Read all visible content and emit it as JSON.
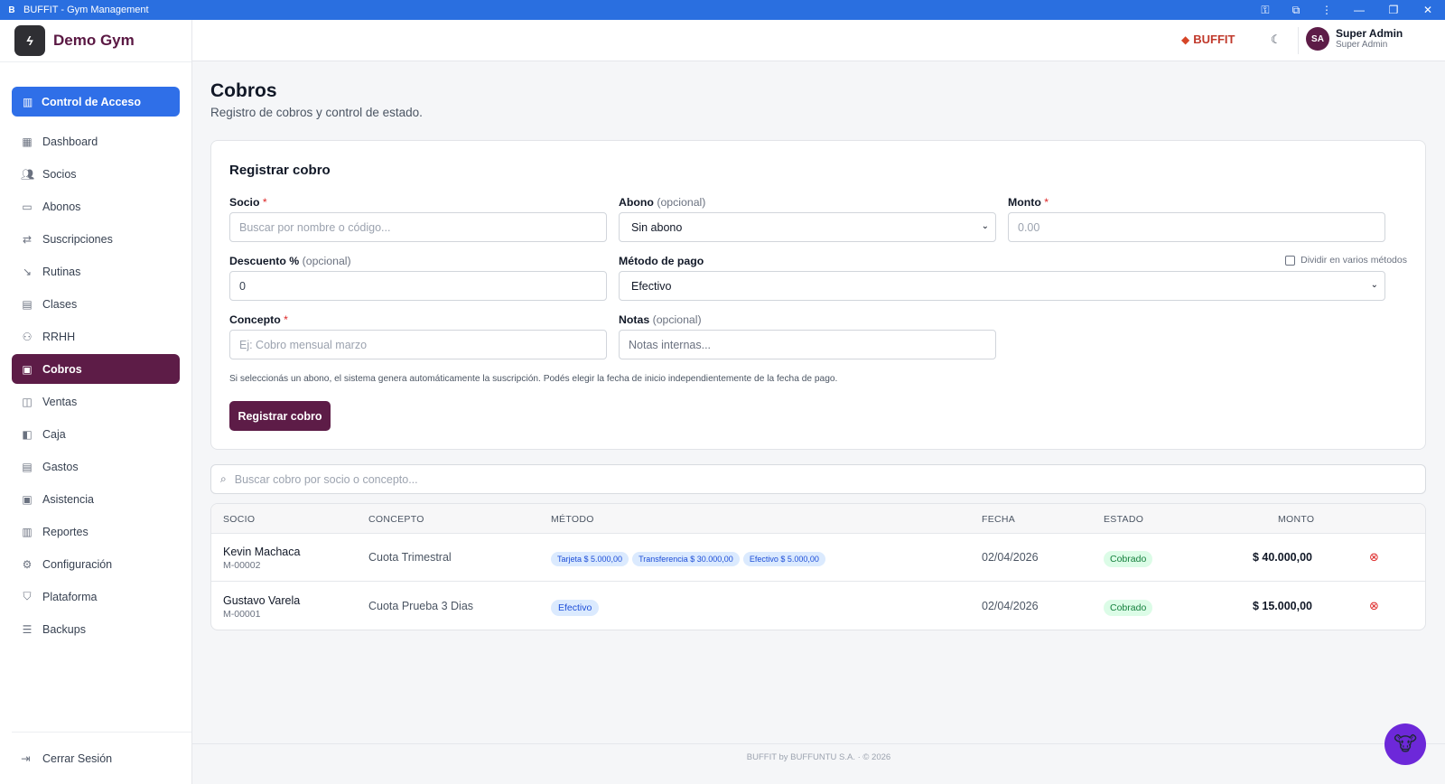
{
  "window": {
    "icon": "B",
    "title": "BUFFIT - Gym Management",
    "accent": "#2a6fe0"
  },
  "sidebar": {
    "brand_name": "Demo Gym",
    "brand_icon": "bolt-logo-icon",
    "access_button": "Control de Acceso",
    "items": [
      {
        "label": "Dashboard",
        "icon": "grid-icon"
      },
      {
        "label": "Socios",
        "icon": "users-icon"
      },
      {
        "label": "Abonos",
        "icon": "card-icon"
      },
      {
        "label": "Suscripciones",
        "icon": "repeat-icon"
      },
      {
        "label": "Rutinas",
        "icon": "dumbbell-icon"
      },
      {
        "label": "Clases",
        "icon": "calendar-icon"
      },
      {
        "label": "RRHH",
        "icon": "staff-icon"
      },
      {
        "label": "Cobros",
        "icon": "receipt-icon",
        "active": true
      },
      {
        "label": "Ventas",
        "icon": "bag-icon"
      },
      {
        "label": "Caja",
        "icon": "wallet-icon"
      },
      {
        "label": "Gastos",
        "icon": "document-icon"
      },
      {
        "label": "Asistencia",
        "icon": "clipboard-icon"
      },
      {
        "label": "Reportes",
        "icon": "bar-chart-icon"
      },
      {
        "label": "Configuración",
        "icon": "gear-icon"
      },
      {
        "label": "Plataforma",
        "icon": "shield-icon"
      },
      {
        "label": "Backups",
        "icon": "database-icon"
      }
    ],
    "logout": "Cerrar Sesión",
    "active_color": "#5d1c47",
    "access_color": "#2f6fe8"
  },
  "topbar": {
    "logo_text": "BUFFIT",
    "user_initials": "SA",
    "user_name": "Super Admin",
    "user_role": "Super Admin"
  },
  "page": {
    "title": "Cobros",
    "subtitle": "Registro de cobros y control de estado."
  },
  "form": {
    "title": "Registrar cobro",
    "socio_label": "Socio",
    "socio_placeholder": "Buscar por nombre o código...",
    "abono_label": "Abono",
    "abono_opt": "(opcional)",
    "abono_value": "Sin abono",
    "monto_label": "Monto",
    "monto_placeholder": "0.00",
    "descuento_label": "Descuento %",
    "descuento_opt": "(opcional)",
    "descuento_value": "0",
    "metodo_label": "Método de pago",
    "metodo_value": "Efectivo",
    "split_label": "Dividir en varios métodos",
    "concepto_label": "Concepto",
    "concepto_placeholder": "Ej: Cobro mensual marzo",
    "notas_label": "Notas",
    "notas_opt": "(opcional)",
    "notas_placeholder": "Notas internas...",
    "required_mark": "*",
    "helper": "Si seleccionás un abono, el sistema genera automáticamente la suscripción. Podés elegir la fecha de inicio independientemente de la fecha de pago.",
    "submit": "Registrar cobro"
  },
  "search": {
    "placeholder": "Buscar cobro por socio o concepto..."
  },
  "table": {
    "columns": [
      "SOCIO",
      "CONCEPTO",
      "MÉTODO",
      "FECHA",
      "ESTADO",
      "MONTO"
    ],
    "rows": [
      {
        "name": "Kevin Machaca",
        "code": "M-00002",
        "concept": "Cuota Trimestral",
        "methods": [
          "Tarjeta $ 5.000,00",
          "Transferencia $ 30.000,00",
          "Efectivo $ 5.000,00"
        ],
        "date": "02/04/2026",
        "status": "Cobrado",
        "amount": "$ 40.000,00"
      },
      {
        "name": "Gustavo Varela",
        "code": "M-00001",
        "concept": "Cuota Prueba 3 Dias",
        "methods": [
          "Efectivo"
        ],
        "date": "02/04/2026",
        "status": "Cobrado",
        "amount": "$ 15.000,00"
      }
    ]
  },
  "footer": "BUFFIT by BUFFUNTU S.A. · © 2026"
}
